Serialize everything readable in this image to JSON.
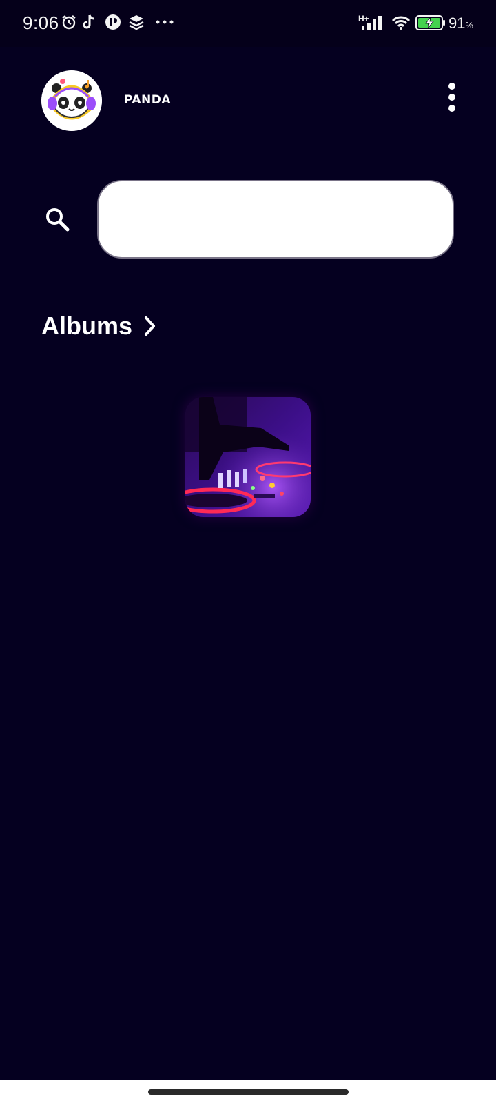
{
  "status_bar": {
    "time": "9:06",
    "network_type": "H+",
    "battery_level": "91",
    "battery_unit": "%",
    "icons": [
      "alarm-icon",
      "tiktok-icon",
      "app-notification-icon",
      "layers-icon",
      "more-notifications-icon",
      "signal-icon",
      "wifi-icon",
      "battery-charging-icon"
    ]
  },
  "header": {
    "profile_name": "PANDA",
    "avatar_icon": "panda-headphones-logo",
    "menu_icon": "more-vertical-icon"
  },
  "search": {
    "icon": "search-icon",
    "value": "",
    "placeholder": ""
  },
  "albums": {
    "title": "Albums",
    "chevron_icon": "chevron-right-icon",
    "items": [
      {
        "image": "dj-turntable-photo"
      }
    ]
  },
  "colors": {
    "background": "#050020",
    "text": "#ffffff",
    "search_background": "#ffffff",
    "accent_purple": "#7b2fd0",
    "accent_red": "#ff2a55"
  }
}
